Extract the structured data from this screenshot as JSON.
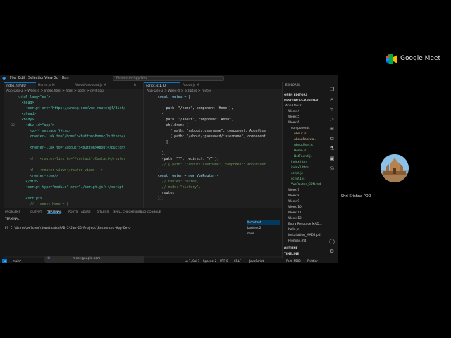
{
  "meet": {
    "brand": "Google Meet",
    "participant_name": "Shri Krishna POD"
  },
  "menu": [
    "File",
    "Edit",
    "Selection",
    "View",
    "Go",
    "Run"
  ],
  "command_search": {
    "placeholder": "Resources-App-Dev"
  },
  "left_editor": {
    "tabs": [
      "index.html U",
      "Home.js M",
      "AboutPassword.js M",
      "b"
    ],
    "breadcrumb": "App-Dev-2 > Week-4 > index.html > html > body > div#app",
    "lines": [
      {
        "n": "",
        "t": "<html lang=\"en\">"
      },
      {
        "n": "",
        "t": "  <head>"
      },
      {
        "n": "",
        "t": "    <script src=\"https://unpkg.com/vue-router@4/dist/"
      },
      {
        "n": "",
        "t": "  </head>"
      },
      {
        "n": "",
        "t": "  <body>"
      },
      {
        "n": "12",
        "t": "    <div id=\"app\">"
      },
      {
        "n": "",
        "t": "      <p>{{ message }}</p>"
      },
      {
        "n": "",
        "t": "      <router-link to=\"/home\"><button>Home</button></"
      },
      {
        "n": "",
        "t": ""
      },
      {
        "n": "",
        "t": "      <router-link to=\"/about\"><button>About</button>"
      },
      {
        "n": "",
        "t": ""
      },
      {
        "n": "",
        "t": "      <!-- <router-link to=\"/contact\">Contact</router"
      },
      {
        "n": "",
        "t": ""
      },
      {
        "n": "",
        "t": "      <!-- <router-view></router-view> -->"
      },
      {
        "n": "",
        "t": "      <router-view/>"
      },
      {
        "n": "",
        "t": "    </div>"
      },
      {
        "n": "",
        "t": "    <script type=\"module\" src=\"./script.js\"></script"
      },
      {
        "n": "",
        "t": ""
      },
      {
        "n": "",
        "t": "    <script>"
      },
      {
        "n": "",
        "t": "      //   const home = {"
      },
      {
        "n": "",
        "t": "      //     template:"
      }
    ]
  },
  "right_editor": {
    "tabs": [
      "script.js 1, U",
      "About.js M"
    ],
    "breadcrumb": "App-Dev-2 > Week-4 > script.js > routes",
    "lines": [
      {
        "n": "",
        "t": "const routes = ["
      },
      {
        "n": "",
        "t": ""
      },
      {
        "n": "",
        "t": "  { path: \"/home\", component: Home },"
      },
      {
        "n": "",
        "t": "  {"
      },
      {
        "n": "",
        "t": "    path: \"/about\", component: About,"
      },
      {
        "n": "",
        "t": "    children: ["
      },
      {
        "n": "",
        "t": "      { path: \"/about/:username\", component: AboutUse"
      },
      {
        "n": "",
        "t": "      { path: \"/about/:password/:username\", component"
      },
      {
        "n": "",
        "t": "    ]"
      },
      {
        "n": "",
        "t": ""
      },
      {
        "n": "",
        "t": "  },"
      },
      {
        "n": "",
        "t": "  {path: \"*\", redirect: \"/\" },"
      },
      {
        "n": "",
        "t": "  // { path: \"/about/:username\", component: AboutUser"
      },
      {
        "n": "",
        "t": "];"
      },
      {
        "n": "",
        "t": "const router = new VueRouter({"
      },
      {
        "n": "",
        "t": "  // routes: routes,"
      },
      {
        "n": "",
        "t": "  // mode: \"history\","
      },
      {
        "n": "",
        "t": "  routes,"
      },
      {
        "n": "",
        "t": "});"
      },
      {
        "n": "",
        "t": ""
      },
      {
        "n": "",
        "t": "const app = new Vue({    Variable 'app' is declared b"
      }
    ]
  },
  "panel": {
    "tabs": [
      "PROBLEMS",
      "OUTPUT",
      "TERMINAL",
      "PORTS",
      "AZURE",
      "GITLENS",
      "SPELL CHECKER",
      "DEBUG CONSOLE"
    ],
    "active_tab": "TERMINAL",
    "terminal_label": "TERMINAL",
    "prompt": "PS C:\\Users\\welcome\\Downloads\\MAD-2\\Jan-26-Project\\Resources-App-Dev>",
    "sessions": [
      "lt-content",
      "backend2",
      "node"
    ]
  },
  "status": {
    "left": "main*",
    "launch": "Launch",
    "position": "Ln 7, Col 3",
    "spaces": "Spaces: 2",
    "encoding": "UTF-8",
    "eol": "CRLF",
    "language": "JavaScript",
    "port": "Port: 5500",
    "prettier": "Prettier"
  },
  "explorer": {
    "title": "EXPLORER",
    "open_editors": "OPEN EDITORS",
    "root": "RESOURCES-APP-DEV",
    "items": [
      {
        "label": "App-Dev-2",
        "depth": 0,
        "color": "#cccccc"
      },
      {
        "label": "Week-4",
        "depth": 1,
        "color": "#cccccc"
      },
      {
        "label": "Week-5",
        "depth": 1,
        "color": "#cccccc"
      },
      {
        "label": "Week-6",
        "depth": 1,
        "color": "#cccccc"
      },
      {
        "label": "components",
        "depth": 2,
        "color": "#cccccc"
      },
      {
        "label": "About.js",
        "depth": 3,
        "color": "#e2c08d"
      },
      {
        "label": "AboutPasswo...",
        "depth": 3,
        "color": "#e2c08d"
      },
      {
        "label": "AboutUser.js",
        "depth": 3,
        "color": "#73c991"
      },
      {
        "label": "Home.js",
        "depth": 3,
        "color": "#73c991"
      },
      {
        "label": "NotFound.js",
        "depth": 3,
        "color": "#73c991"
      },
      {
        "label": "index.html",
        "depth": 2,
        "color": "#73c991"
      },
      {
        "label": "index1.html",
        "depth": 2,
        "color": "#73c991"
      },
      {
        "label": "script.js",
        "depth": 2,
        "color": "#73c991"
      },
      {
        "label": "script1.js",
        "depth": 2,
        "color": "#73c991"
      },
      {
        "label": "VueRouter_CDN.md",
        "depth": 2,
        "color": "#73c991"
      },
      {
        "label": "Week-7",
        "depth": 1,
        "color": "#cccccc"
      },
      {
        "label": "Week-8",
        "depth": 1,
        "color": "#cccccc"
      },
      {
        "label": "Week-9",
        "depth": 1,
        "color": "#cccccc"
      },
      {
        "label": "Week-10",
        "depth": 1,
        "color": "#cccccc"
      },
      {
        "label": "Week-11",
        "depth": 1,
        "color": "#cccccc"
      },
      {
        "label": "Week-12",
        "depth": 1,
        "color": "#cccccc"
      },
      {
        "label": "Extra Resource MAD...",
        "depth": 1,
        "color": "#cccccc"
      },
      {
        "label": "hello.js",
        "depth": 1,
        "color": "#cccccc"
      },
      {
        "label": "Installation_MAD2.pdf",
        "depth": 1,
        "color": "#cccccc"
      },
      {
        "label": "Promise.md",
        "depth": 1,
        "color": "#cccccc"
      }
    ],
    "outline": "OUTLINE",
    "timeline": "TIMELINE"
  },
  "share_bar": {
    "text": "meet.google.com"
  },
  "colors": {
    "accent": "#0078d4",
    "modified": "#e2c08d",
    "untracked": "#73c991"
  }
}
